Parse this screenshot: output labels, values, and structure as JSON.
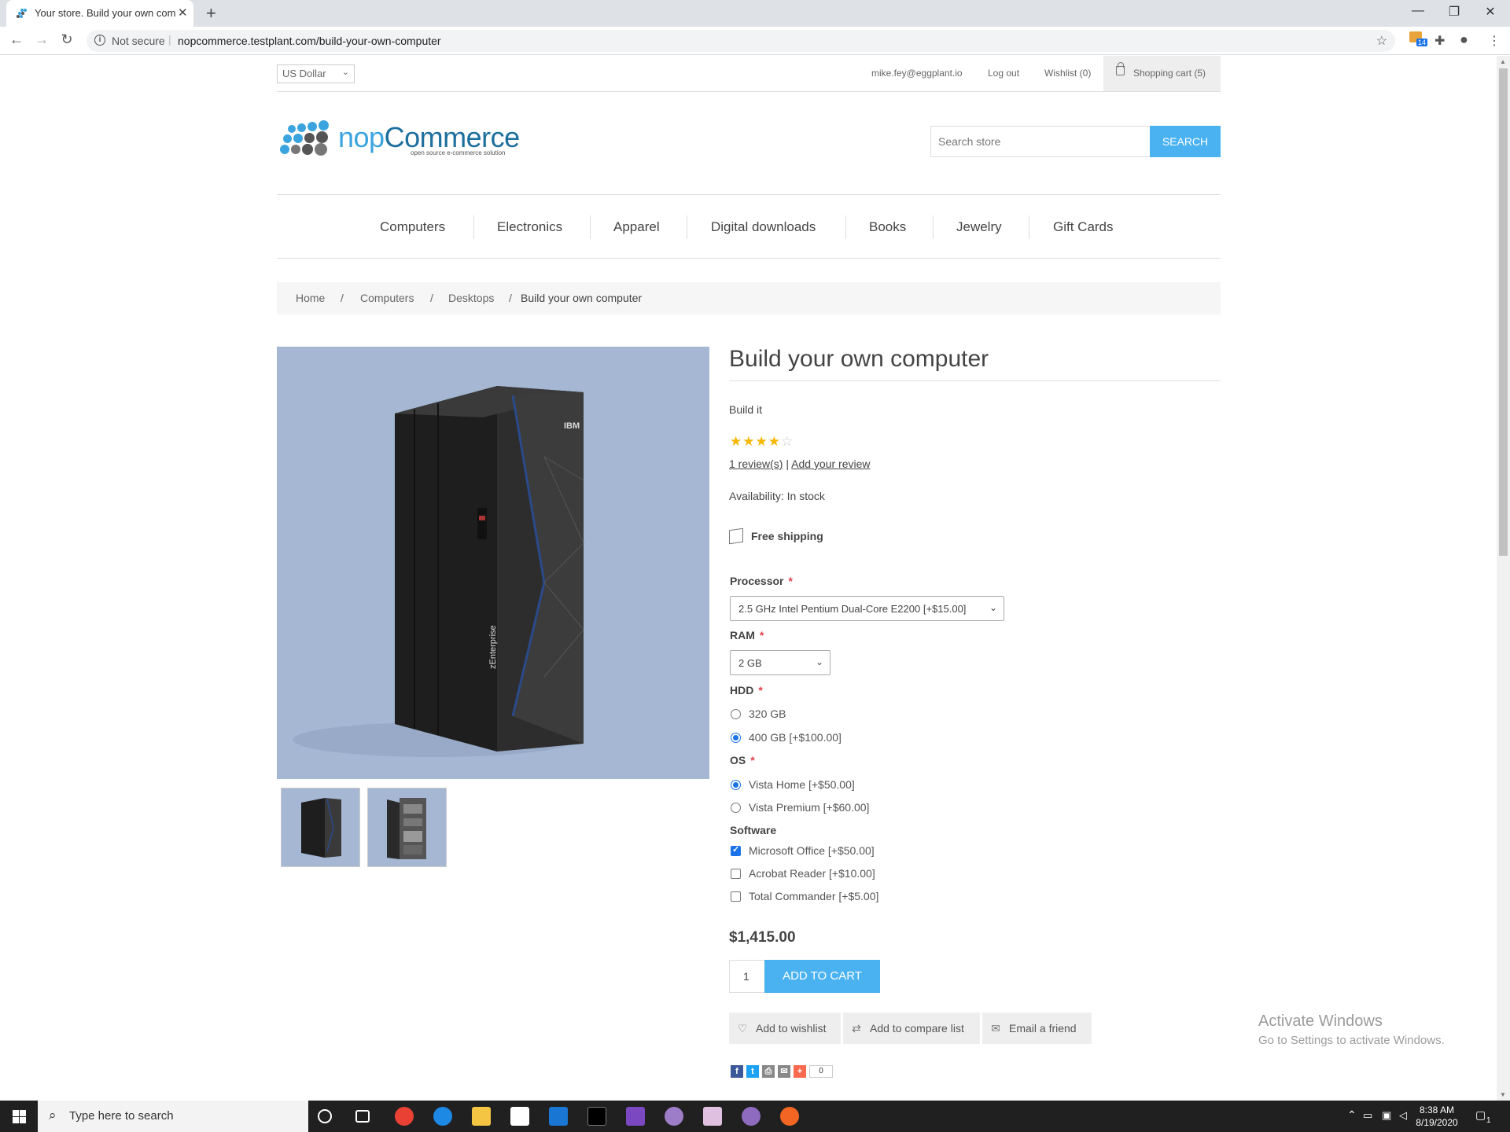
{
  "browser": {
    "tab_title": "Your store. Build your own comp",
    "not_secure": "Not secure",
    "url": "nopcommerce.testplant.com/build-your-own-computer",
    "extension_badge": "14"
  },
  "header": {
    "currency": "US Dollar",
    "account_email": "mike.fey@eggplant.io",
    "logout": "Log out",
    "wishlist": "Wishlist (0)",
    "cart": "Shopping cart (5)",
    "logo_word_a": "nop",
    "logo_word_b": "Commerce",
    "logo_tagline": "open source e-commerce solution",
    "search_placeholder": "Search store",
    "search_button": "SEARCH"
  },
  "menu": [
    "Computers",
    "Electronics",
    "Apparel",
    "Digital downloads",
    "Books",
    "Jewelry",
    "Gift Cards"
  ],
  "breadcrumb": {
    "items": [
      "Home",
      "Computers",
      "Desktops",
      "Build your own computer"
    ],
    "separator": "/"
  },
  "product": {
    "title": "Build your own computer",
    "short_description": "Build it",
    "rating": 4,
    "rating_max": 5,
    "reviews_link": "1 review(s)",
    "review_sep": "|",
    "add_review": "Add your review",
    "availability_label": "Availability:",
    "availability_value": "In stock",
    "shipping": "Free shipping",
    "processor_label": "Processor",
    "processor_value": "2.5 GHz Intel Pentium Dual-Core E2200 [+$15.00]",
    "ram_label": "RAM",
    "ram_value": "2 GB",
    "hdd_label": "HDD",
    "hdd_options": [
      {
        "label": "320 GB",
        "selected": false
      },
      {
        "label": "400 GB [+$100.00]",
        "selected": true
      }
    ],
    "os_label": "OS",
    "os_options": [
      {
        "label": "Vista Home [+$50.00]",
        "selected": true
      },
      {
        "label": "Vista Premium [+$60.00]",
        "selected": false
      }
    ],
    "software_label": "Software",
    "software_options": [
      {
        "label": "Microsoft Office [+$50.00]",
        "checked": true
      },
      {
        "label": "Acrobat Reader [+$10.00]",
        "checked": false
      },
      {
        "label": "Total Commander [+$5.00]",
        "checked": false
      }
    ],
    "required_mark": "*",
    "price": "$1,415.00",
    "quantity": "1",
    "add_to_cart": "ADD TO CART",
    "add_to_wishlist": "Add to wishlist",
    "add_to_compare": "Add to compare list",
    "email_friend": "Email a friend",
    "share_count": "0",
    "image_brand": "IBM",
    "image_model": "zEnterprise"
  },
  "watermark": {
    "line1": "Activate Windows",
    "line2": "Go to Settings to activate Windows."
  },
  "taskbar": {
    "search_placeholder": "Type here to search",
    "time": "8:38 AM",
    "date": "8/19/2020",
    "notification_count": "1"
  },
  "colors": {
    "accent": "#4ab2f1",
    "image_bg": "#a5b7d2",
    "required": "#e4444c",
    "star": "#f5b700"
  }
}
